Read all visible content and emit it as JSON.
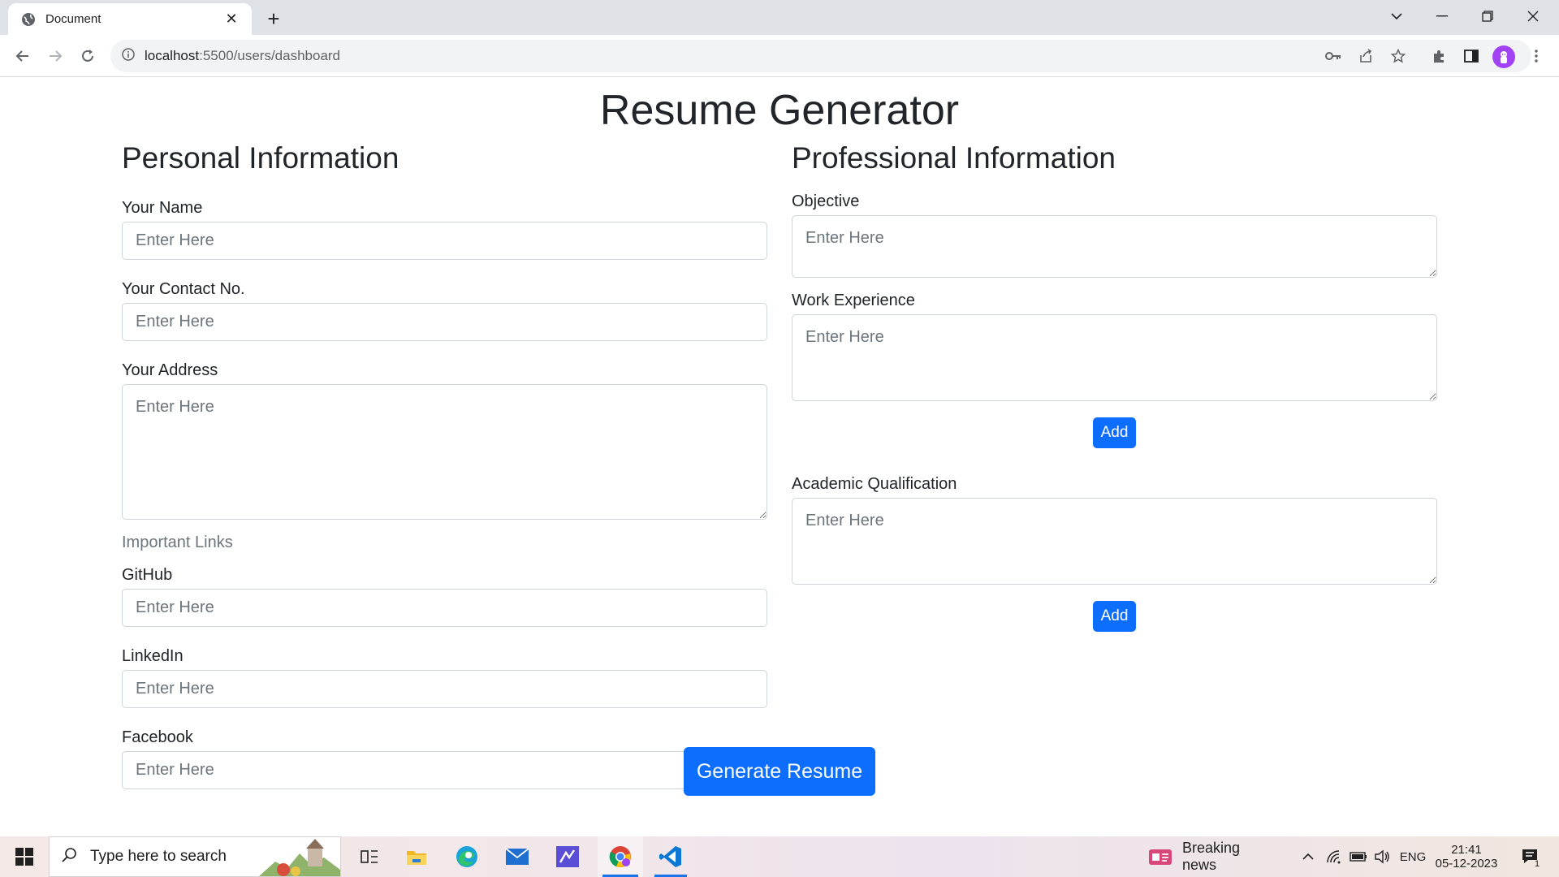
{
  "browser": {
    "tab_title": "Document",
    "url_host": "localhost",
    "url_path": ":5500/users/dashboard"
  },
  "page": {
    "title": "Resume Generator",
    "personal": {
      "heading": "Personal Information",
      "name_label": "Your Name",
      "contact_label": "Your Contact No.",
      "address_label": "Your Address",
      "links_heading": "Important Links",
      "github_label": "GitHub",
      "linkedin_label": "LinkedIn",
      "facebook_label": "Facebook"
    },
    "professional": {
      "heading": "Professional Information",
      "objective_label": "Objective",
      "work_label": "Work Experience",
      "add_work_button": "Add",
      "academic_label": "Academic Qualification",
      "add_academic_button": "Add"
    },
    "placeholder": "Enter Here",
    "generate_button": "Generate Resume"
  },
  "taskbar": {
    "search_placeholder": "Type here to search",
    "news": "Breaking news",
    "language": "ENG",
    "time": "21:41",
    "date": "05-12-2023",
    "notification_count": "1"
  },
  "colors": {
    "primary": "#0d6efd",
    "tabbar": "#dee1e6",
    "avatar": "#a142f4"
  }
}
